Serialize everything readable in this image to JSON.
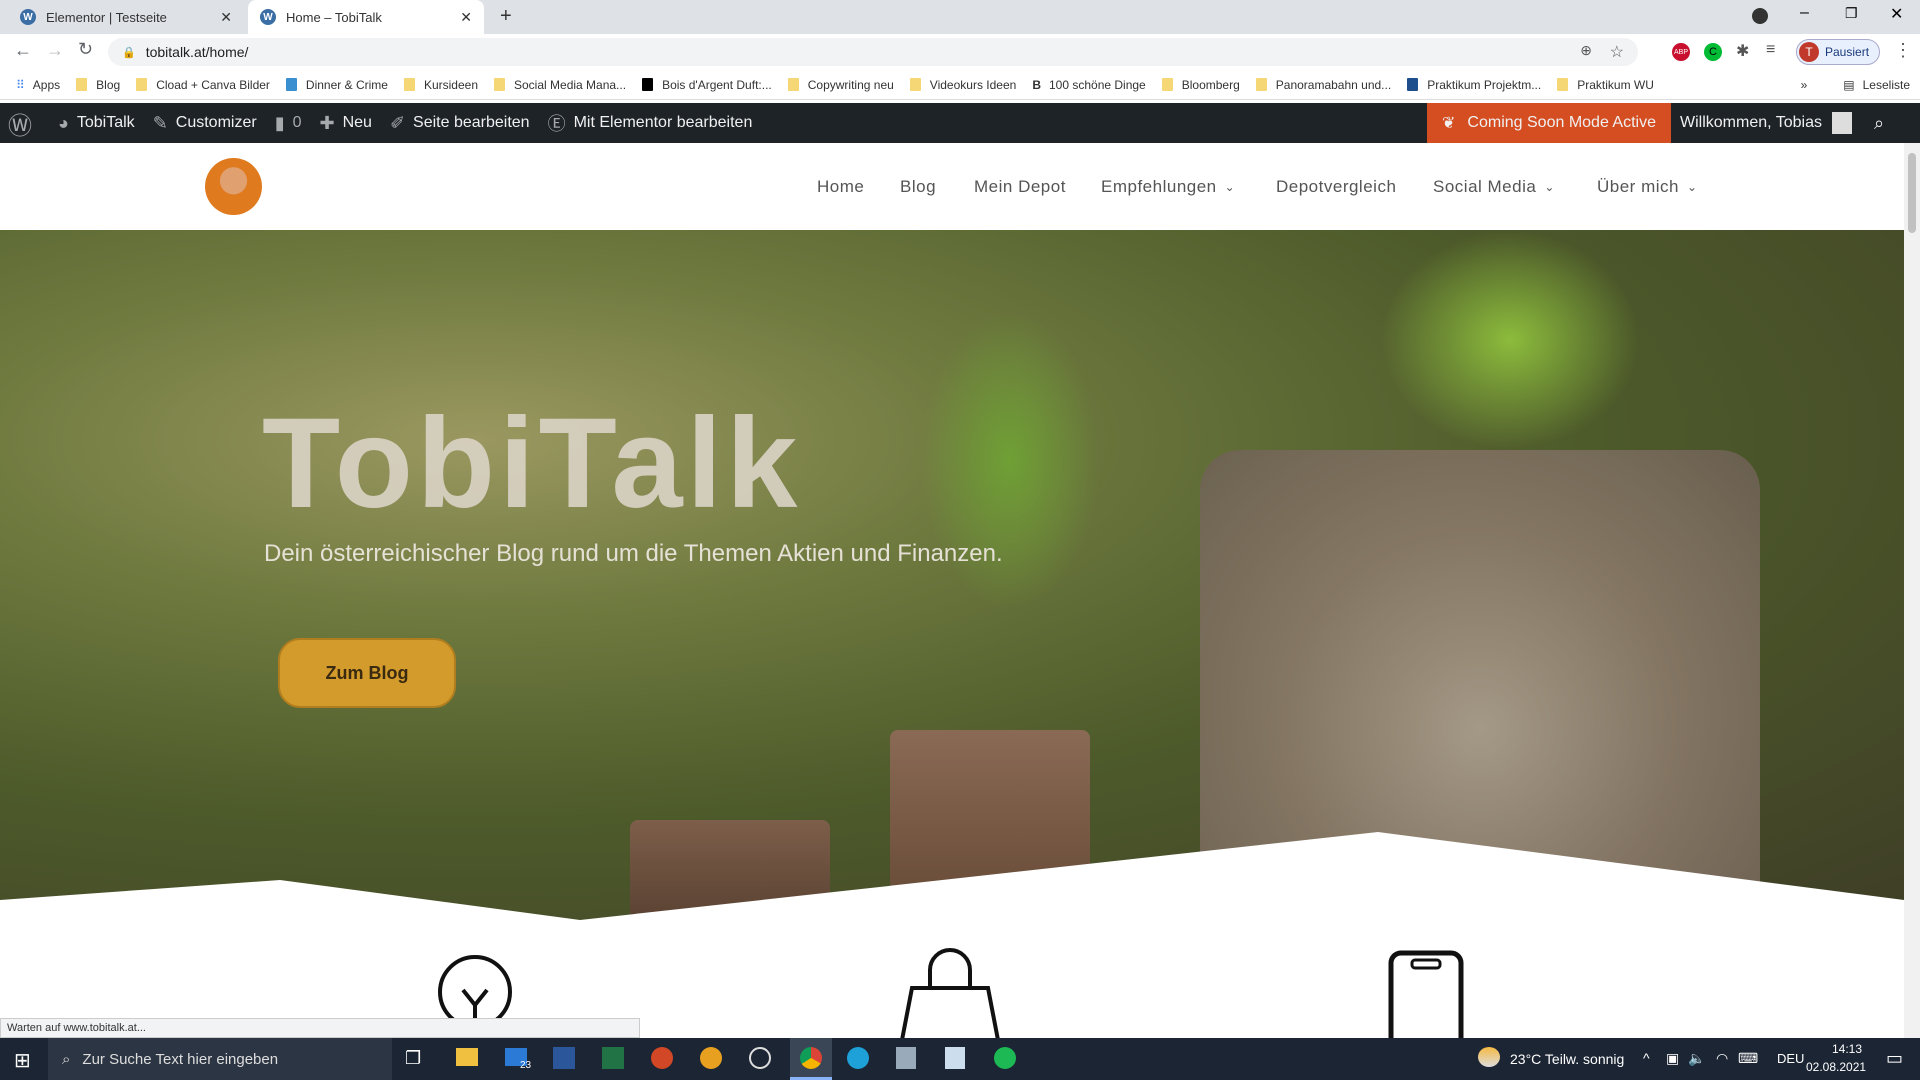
{
  "browser": {
    "tabs": [
      {
        "title": "Elementor | Testseite",
        "active": false
      },
      {
        "title": "Home – TobiTalk",
        "active": true
      }
    ],
    "url": "tobitalk.at/home/",
    "profile_label": "Pausiert",
    "profile_initial": "T",
    "extensions": [
      "ABP",
      "C"
    ],
    "bookmarks": [
      "Apps",
      "Blog",
      "Cload + Canva Bilder",
      "Dinner & Crime",
      "Kursideen",
      "Social Media Mana...",
      "Bois d'Argent Duft:...",
      "Copywriting neu",
      "Videokurs Ideen",
      "100 schöne Dinge",
      "Bloomberg",
      "Panoramabahn und...",
      "Praktikum Projektm...",
      "Praktikum WU"
    ],
    "reading_list": "Leseliste"
  },
  "wp_admin_bar": {
    "site": "TobiTalk",
    "customizer": "Customizer",
    "comments": "0",
    "new": "Neu",
    "edit_page": "Seite bearbeiten",
    "elementor": "Mit Elementor bearbeiten",
    "coming_soon": "Coming Soon Mode Active",
    "welcome": "Willkommen, Tobias",
    "coming_soon_color": "#d54e21"
  },
  "site": {
    "nav": [
      "Home",
      "Blog",
      "Mein Depot",
      "Empfehlungen",
      "Depotvergleich",
      "Social Media",
      "Über mich"
    ],
    "hero": {
      "title": "TobiTalk",
      "subtitle": "Dein österreichischer Blog rund um die Themen Aktien und Finanzen.",
      "button": "Zum Blog",
      "button_color": "#d39a2c"
    },
    "feature_icons": [
      "lightbulb-icon",
      "shopping-bag-icon",
      "smartphone-icon"
    ]
  },
  "status_bar": "Warten auf www.tobitalk.at...",
  "taskbar": {
    "search_placeholder": "Zur Suche Text hier eingeben",
    "mail_badge": "23",
    "weather": "23°C  Teilw. sonnig",
    "language": "DEU",
    "time": "14:13",
    "date": "02.08.2021"
  }
}
